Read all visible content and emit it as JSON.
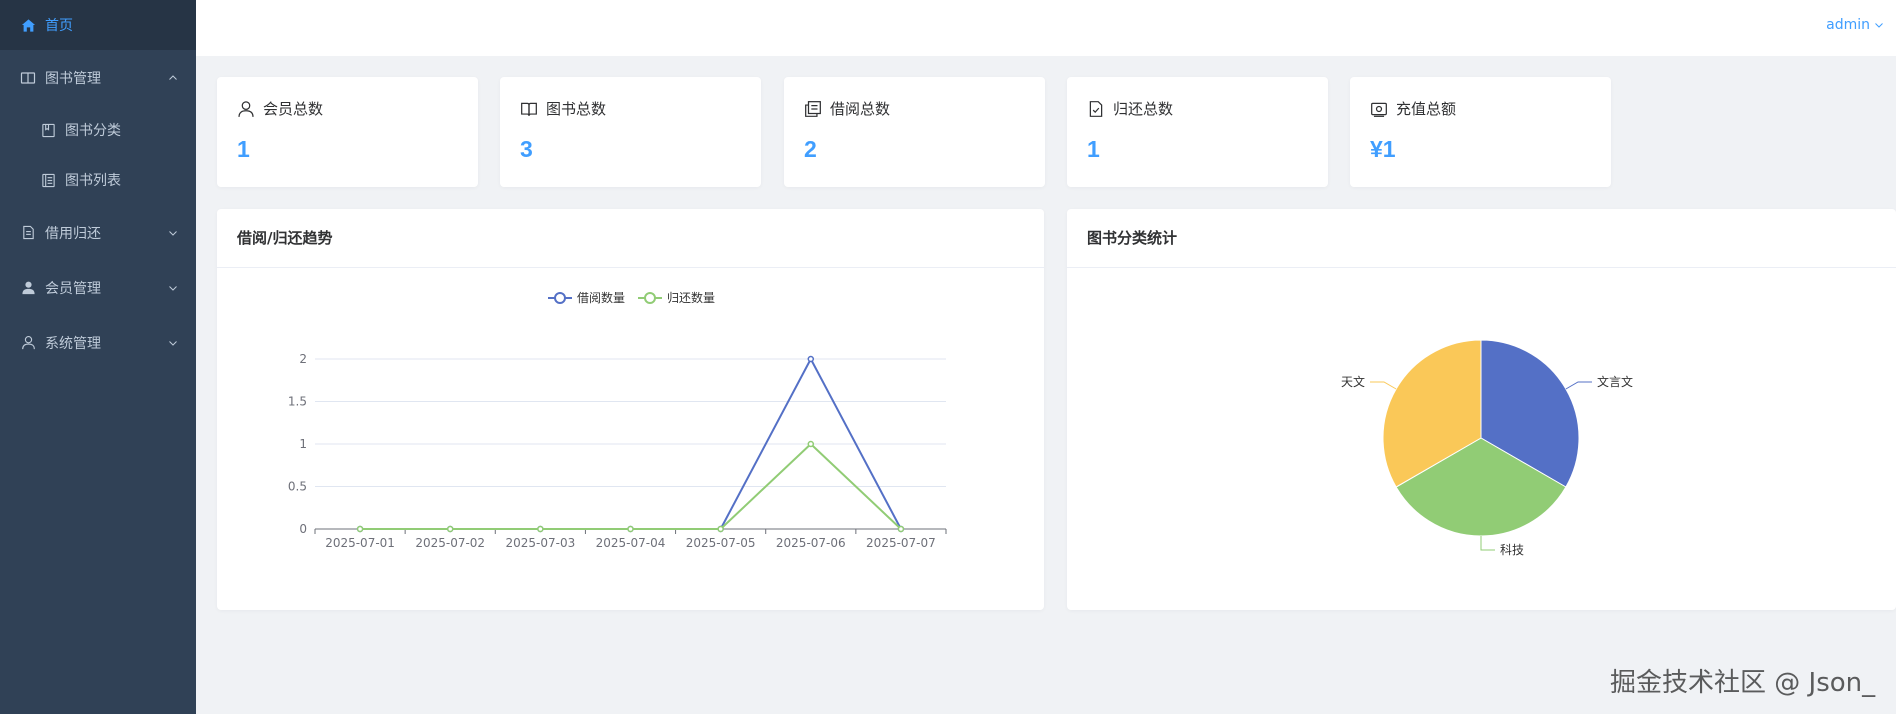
{
  "sidebar": {
    "items": [
      {
        "label": "首页",
        "icon": "home-icon",
        "active": true
      },
      {
        "label": "图书管理",
        "icon": "book-icon",
        "expanded": true,
        "children": [
          {
            "label": "图书分类",
            "icon": "category-icon"
          },
          {
            "label": "图书列表",
            "icon": "list-icon"
          }
        ]
      },
      {
        "label": "借用归还",
        "icon": "document-icon"
      },
      {
        "label": "会员管理",
        "icon": "user-filled-icon"
      },
      {
        "label": "系统管理",
        "icon": "user-icon"
      }
    ]
  },
  "header": {
    "user": "admin"
  },
  "stats": [
    {
      "label": "会员总数",
      "value": "1",
      "icon": "user-icon"
    },
    {
      "label": "图书总数",
      "value": "3",
      "icon": "book-open-icon"
    },
    {
      "label": "借阅总数",
      "value": "2",
      "icon": "copy-document-icon"
    },
    {
      "label": "归还总数",
      "value": "1",
      "icon": "document-checked-icon"
    },
    {
      "label": "充值总额",
      "value": "¥1",
      "icon": "wallet-icon"
    }
  ],
  "trend_panel": {
    "title": "借阅/归还趋势"
  },
  "category_panel": {
    "title": "图书分类统计"
  },
  "colors": {
    "accent": "#409eff",
    "sidebar": "#304156",
    "series_blue": "#5470c6",
    "series_green": "#91cc75",
    "series_yellow": "#fac858"
  },
  "chart_data": [
    {
      "type": "line",
      "x": [
        "2025-07-01",
        "2025-07-02",
        "2025-07-03",
        "2025-07-04",
        "2025-07-05",
        "2025-07-06",
        "2025-07-07"
      ],
      "series": [
        {
          "name": "借阅数量",
          "values": [
            0,
            0,
            0,
            0,
            0,
            2,
            0
          ],
          "color": "#5470c6"
        },
        {
          "name": "归还数量",
          "values": [
            0,
            0,
            0,
            0,
            0,
            1,
            0
          ],
          "color": "#91cc75"
        }
      ],
      "yticks": [
        "0",
        "0.5",
        "1",
        "1.5",
        "2"
      ],
      "ylim": [
        0,
        2
      ],
      "legend": "top-center",
      "grid": true
    },
    {
      "type": "pie",
      "slices": [
        {
          "name": "文言文",
          "value": 1,
          "color": "#5470c6"
        },
        {
          "name": "科技",
          "value": 1,
          "color": "#91cc75"
        },
        {
          "name": "天文",
          "value": 1,
          "color": "#fac858"
        }
      ]
    }
  ],
  "watermark": "掘金技术社区 @ Json_"
}
